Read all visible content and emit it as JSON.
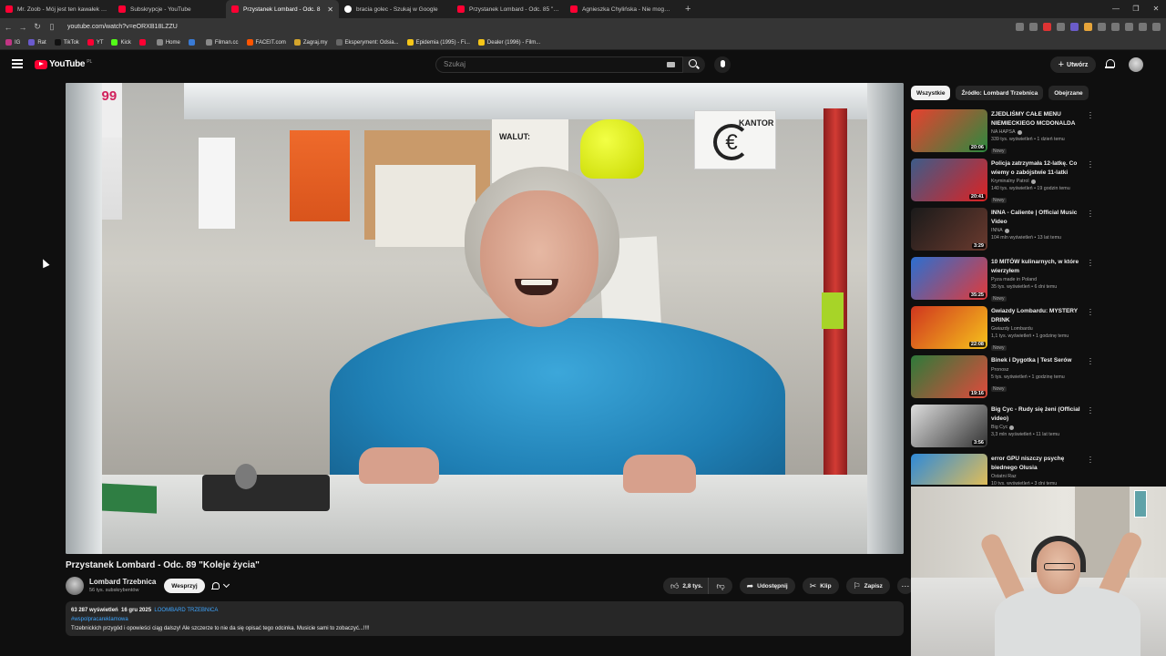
{
  "browser": {
    "tabs": [
      {
        "label": "Mr. Zoob - Mój jest ten kawałek pod",
        "active": false,
        "favicon": "youtube"
      },
      {
        "label": "Subskrypcje - YouTube",
        "active": false,
        "favicon": "youtube"
      },
      {
        "label": "Przystanek Lombard - Odc. 8",
        "active": true,
        "favicon": "youtube"
      },
      {
        "label": "bracia golec - Szukaj w Google",
        "active": false,
        "favicon": "google"
      },
      {
        "label": "Przystanek Lombard - Odc. 85 \"Via V",
        "active": false,
        "favicon": "youtube"
      },
      {
        "label": "Agnieszka Chylińska - Nie mogę Cię",
        "active": false,
        "favicon": "youtube"
      }
    ],
    "url": "youtube.com/watch?v=eORXB18LZZU",
    "bookmarks": [
      "IG",
      "Rat",
      "TikTok",
      "YT",
      "Kick",
      "",
      "Home",
      "",
      "Filman.cc",
      "FACEIT.com",
      "Zagraj.my",
      "Eksperyment: Odsia...",
      "Epidemia (1995) - Fi...",
      "Dealer (1996) - Film..."
    ],
    "window_controls": [
      "—",
      "❐",
      "✕"
    ]
  },
  "youtube": {
    "logo_text": "YouTube",
    "logo_country": "PL",
    "search_placeholder": "Szukaj",
    "create_label": "Utwórz"
  },
  "video": {
    "title": "Przystanek Lombard - Odc. 89 \"Koleje życia\"",
    "channel": "Lombard Trzebnica",
    "subscribers": "56 tys. subskrybentów",
    "support_label": "Wesprzyj",
    "likes": "2,8 tys.",
    "share_label": "Udostępnij",
    "clip_label": "Klip",
    "save_label": "Zapisz",
    "views": "63 287 wyświetleń",
    "date": "16 gru 2025",
    "channel_tag": "LOOMBARD TRZEBNICA",
    "hashtag": "#wspolpracareklamowa",
    "description": "Trzebnickich przygód i opowieści ciąg dalszy! Ale szczerze to nie da się opisać tego odcinka. Musicie sami to zobaczyć...!!!!"
  },
  "sidebar": {
    "chips": [
      {
        "label": "Wszystkie",
        "active": true
      },
      {
        "label": "Źródło: Lombard Trzebnica",
        "active": false
      },
      {
        "label": "Obejrzane",
        "active": false
      }
    ],
    "recommendations": [
      {
        "title": "ZJEDLIŚMY CAŁE MENU NIEMIECKIEGO MCDONALDA",
        "channel": "NA HAPSA",
        "verified": true,
        "meta": "339 tys. wyświetleń • 1 dzień temu",
        "badge": "Nowy",
        "duration": "20:06",
        "thumb": [
          "#e8402f",
          "#2c8a3f"
        ]
      },
      {
        "title": "Policja zatrzymała 12-latkę. Co wiemy o zabójstwie 11-latki",
        "channel": "Kryminalny Patrol",
        "verified": true,
        "meta": "140 tys. wyświetleń • 19 godzin temu",
        "badge": "Nowy",
        "duration": "20:41",
        "thumb": [
          "#3c5c8a",
          "#d22"
        ]
      },
      {
        "title": "INNA - Caliente | Official Music Video",
        "channel": "INNA",
        "verified": true,
        "meta": "104 mln wyświetleń • 13 lat temu",
        "badge": "",
        "duration": "3:29",
        "thumb": [
          "#1a1a1a",
          "#6a3a2e"
        ]
      },
      {
        "title": "10 MITÓW kulinarnych, w które wierzyłem",
        "channel": "Pyza made in Poland",
        "verified": false,
        "meta": "35 tys. wyświetleń • 6 dni temu",
        "badge": "Nowy",
        "duration": "35:25",
        "thumb": [
          "#2b6fd1",
          "#e13a3a"
        ]
      },
      {
        "title": "Gwiazdy Lombardu: MYSTERY DRINK",
        "channel": "Gwiazdy Lombardu",
        "verified": false,
        "meta": "1,1 tys. wyświetleń • 1 godzinę temu",
        "badge": "Nowy",
        "duration": "22:08",
        "thumb": [
          "#d0361f",
          "#f6c21b"
        ]
      },
      {
        "title": "Binek i Dygotka | Test Serów",
        "channel": "Pronosz",
        "verified": false,
        "meta": "5 tys. wyświetleń • 1 godzinę temu",
        "badge": "Nowy",
        "duration": "19:16",
        "thumb": [
          "#2e7a3a",
          "#e04a3c"
        ]
      },
      {
        "title": "Big Cyc - Rudy się żeni (Official video)",
        "channel": "Big Cyc",
        "verified": true,
        "meta": "3,3 mln wyświetleń • 11 lat temu",
        "badge": "",
        "duration": "3:56",
        "thumb": [
          "#ddd",
          "#333"
        ]
      },
      {
        "title": "error GPU niszczy psychę biednego Olusia",
        "channel": "Ostatni Raz",
        "verified": false,
        "meta": "10 tys. wyświetleń • 3 dni temu",
        "badge": "",
        "duration": "38:33",
        "thumb": [
          "#2f8ad8",
          "#f2c24b"
        ]
      }
    ]
  },
  "player_scene": {
    "sign_text": "KANTOR",
    "poster_text": "9900 99",
    "walut_label": "WALUT:"
  }
}
